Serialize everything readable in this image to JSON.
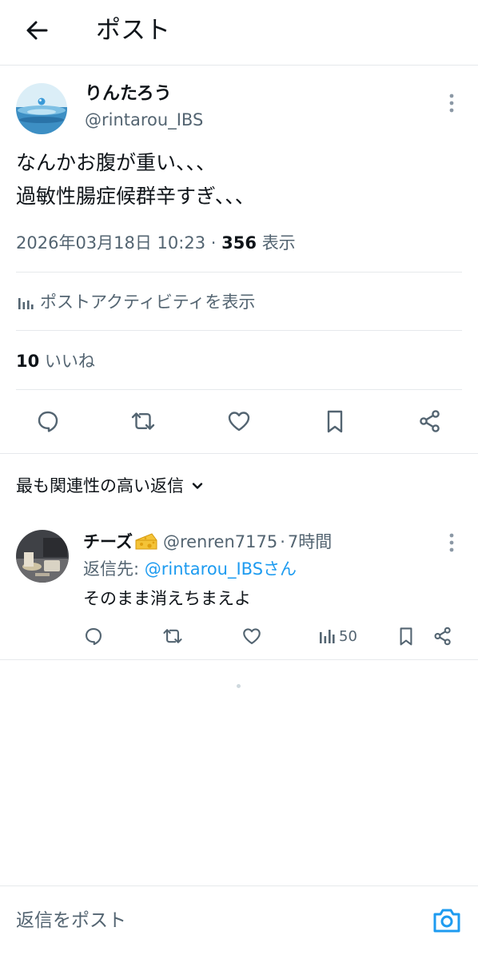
{
  "header": {
    "title": "ポスト",
    "back_icon": "arrow-left-icon"
  },
  "post": {
    "author_name": "りんたろう",
    "author_handle": "@rintarou_IBS",
    "text_line1": "なんかお腹が重い、、、",
    "text_line2": "過敏性腸症候群辛すぎ、、、",
    "timestamp": "2026年03月18日 10:23",
    "separator": "·",
    "views": "356",
    "views_label": "表示",
    "activity_label": "ポストアクティビティを表示",
    "likes_count": "10",
    "likes_label": "いいね"
  },
  "sort": {
    "label": "最も関連性の高い返信"
  },
  "reply": {
    "name": "チーズ",
    "handle": "@renren7175",
    "separator": "·",
    "time": "7時間",
    "reply_to_label": "返信先:",
    "reply_to_user": "@rintarou_IBSさん",
    "text": "そのまま消えちまえよ",
    "views": "50"
  },
  "compose": {
    "placeholder": "返信をポスト"
  },
  "colors": {
    "link": "#1d9bf0",
    "muted": "#536471",
    "divider": "#e6e9ec",
    "text": "#0f1419"
  }
}
